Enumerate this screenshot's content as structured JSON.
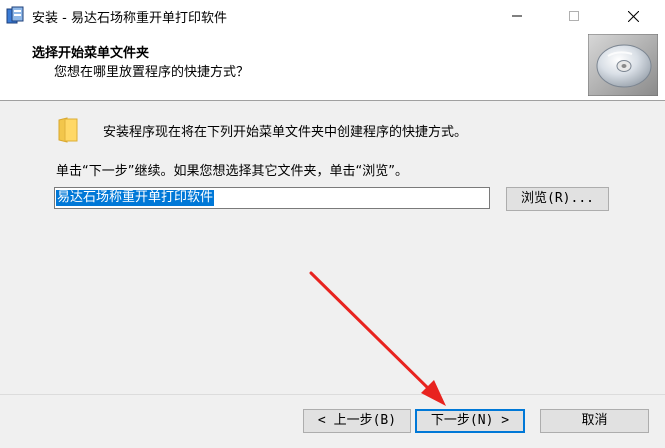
{
  "window": {
    "title": "安装 - 易达石场称重开单打印软件"
  },
  "header": {
    "title": "选择开始菜单文件夹",
    "subtitle": "您想在哪里放置程序的快捷方式？"
  },
  "body": {
    "intro": "安装程序现在将在下列开始菜单文件夹中创建程序的快捷方式。",
    "instruction": "单击“下一步”继续。如果您想选择其它文件夹，单击“浏览”。",
    "folder_value": "易达石场称重开单打印软件",
    "browse_label": "浏览(R)..."
  },
  "footer": {
    "back_label": "< 上一步(B)",
    "next_label": "下一步(N) >",
    "cancel_label": "取消"
  },
  "colors": {
    "accent": "#0078d7",
    "annotation_arrow": "#e8231f"
  }
}
